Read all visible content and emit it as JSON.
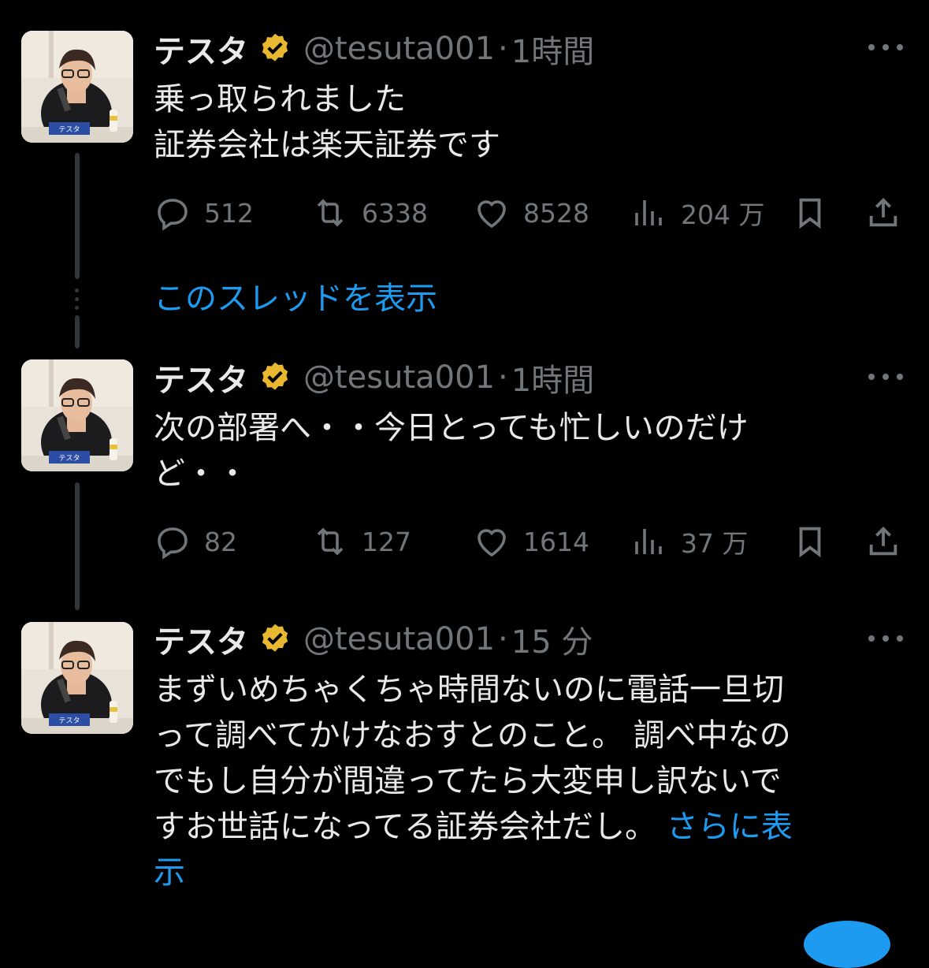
{
  "author": {
    "name": "テスタ",
    "handle": "@tesuta001",
    "avatar_nameplate": "テスタ"
  },
  "tweets": [
    {
      "time": "1時間",
      "lines": [
        "乗っ取られました",
        "証券会社は楽天証券です"
      ],
      "replies": "512",
      "retweets": "6338",
      "likes": "8528",
      "views": "204 万"
    },
    {
      "time": "1時間",
      "lines": [
        "次の部署へ・・今日とっても忙しいのだけ",
        "ど・・"
      ],
      "replies": "82",
      "retweets": "127",
      "likes": "1614",
      "views": "37 万"
    },
    {
      "time": "15 分",
      "lines": [
        "まずいめちゃくちゃ時間ないのに電話一旦切",
        "って調べてかけなおすとのこと。 調べ中なの",
        "でもし自分が間違ってたら大変申し訳ないで",
        "すお世話になってる証券会社だし。 "
      ],
      "more_label": "さらに表",
      "more_label_tail": "示"
    }
  ],
  "show_thread_label": "このスレッドを表示",
  "separator": "·",
  "colors": {
    "background": "#000000",
    "text": "#e7e9ea",
    "muted": "#71767b",
    "link": "#1d9bf0",
    "badge": "#e8b830"
  },
  "icons": [
    "reply-icon",
    "retweet-icon",
    "like-icon",
    "views-icon",
    "bookmark-icon",
    "share-icon",
    "verified-badge-icon",
    "more-icon"
  ]
}
